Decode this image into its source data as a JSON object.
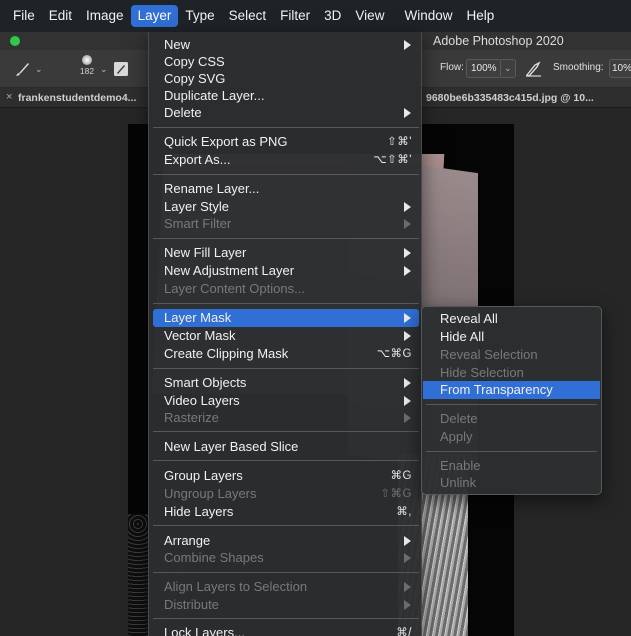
{
  "menubar": {
    "items": [
      "File",
      "Edit",
      "Image",
      "Layer",
      "Type",
      "Select",
      "Filter",
      "3D",
      "View",
      "Window",
      "Help"
    ],
    "active": "Layer"
  },
  "titlebar": {
    "title": "Adobe Photoshop 2020"
  },
  "options": {
    "brush_size": "182",
    "flow_label": "Flow:",
    "flow_value": "100%",
    "smoothing_label": "Smoothing:",
    "smoothing_value": "10%"
  },
  "tabs": {
    "left": "frankenstudentdemo4...",
    "right": "9680be6b335483c415d.jpg @ 10..."
  },
  "layer_menu": [
    {
      "label": "New",
      "shortcut": "",
      "submenu": true,
      "disabled": false
    },
    {
      "label": "Copy CSS",
      "shortcut": "",
      "submenu": false,
      "disabled": false
    },
    {
      "label": "Copy SVG",
      "shortcut": "",
      "submenu": false,
      "disabled": false
    },
    {
      "label": "Duplicate Layer...",
      "shortcut": "",
      "submenu": false,
      "disabled": false
    },
    {
      "label": "Delete",
      "shortcut": "",
      "submenu": true,
      "disabled": false
    },
    {
      "label": "Quick Export as PNG",
      "shortcut": "⇧⌘'",
      "submenu": false,
      "disabled": false
    },
    {
      "label": "Export As...",
      "shortcut": "⌥⇧⌘'",
      "submenu": false,
      "disabled": false
    },
    {
      "label": "Rename Layer...",
      "shortcut": "",
      "submenu": false,
      "disabled": false
    },
    {
      "label": "Layer Style",
      "shortcut": "",
      "submenu": true,
      "disabled": false
    },
    {
      "label": "Smart Filter",
      "shortcut": "",
      "submenu": true,
      "disabled": true
    },
    {
      "label": "New Fill Layer",
      "shortcut": "",
      "submenu": true,
      "disabled": false
    },
    {
      "label": "New Adjustment Layer",
      "shortcut": "",
      "submenu": true,
      "disabled": false
    },
    {
      "label": "Layer Content Options...",
      "shortcut": "",
      "submenu": false,
      "disabled": true
    },
    {
      "label": "Layer Mask",
      "shortcut": "",
      "submenu": true,
      "disabled": false,
      "highlighted": true
    },
    {
      "label": "Vector Mask",
      "shortcut": "",
      "submenu": true,
      "disabled": false
    },
    {
      "label": "Create Clipping Mask",
      "shortcut": "⌥⌘G",
      "submenu": false,
      "disabled": false
    },
    {
      "label": "Smart Objects",
      "shortcut": "",
      "submenu": true,
      "disabled": false
    },
    {
      "label": "Video Layers",
      "shortcut": "",
      "submenu": true,
      "disabled": false
    },
    {
      "label": "Rasterize",
      "shortcut": "",
      "submenu": true,
      "disabled": true
    },
    {
      "label": "New Layer Based Slice",
      "shortcut": "",
      "submenu": false,
      "disabled": false
    },
    {
      "label": "Group Layers",
      "shortcut": "⌘G",
      "submenu": false,
      "disabled": false
    },
    {
      "label": "Ungroup Layers",
      "shortcut": "⇧⌘G",
      "submenu": false,
      "disabled": true
    },
    {
      "label": "Hide Layers",
      "shortcut": "⌘,",
      "submenu": false,
      "disabled": false
    },
    {
      "label": "Arrange",
      "shortcut": "",
      "submenu": true,
      "disabled": false
    },
    {
      "label": "Combine Shapes",
      "shortcut": "",
      "submenu": true,
      "disabled": true
    },
    {
      "label": "Align Layers to Selection",
      "shortcut": "",
      "submenu": true,
      "disabled": true
    },
    {
      "label": "Distribute",
      "shortcut": "",
      "submenu": true,
      "disabled": true
    },
    {
      "label": "Lock Layers...",
      "shortcut": "⌘/",
      "submenu": false,
      "disabled": false
    }
  ],
  "layer_mask_submenu": [
    {
      "label": "Reveal All",
      "disabled": false
    },
    {
      "label": "Hide All",
      "disabled": false
    },
    {
      "label": "Reveal Selection",
      "disabled": true
    },
    {
      "label": "Hide Selection",
      "disabled": true
    },
    {
      "label": "From Transparency",
      "disabled": false,
      "highlighted": true
    },
    {
      "label": "Delete",
      "disabled": true
    },
    {
      "label": "Apply",
      "disabled": true
    },
    {
      "label": "Enable",
      "disabled": true
    },
    {
      "label": "Unlink",
      "disabled": true
    }
  ]
}
